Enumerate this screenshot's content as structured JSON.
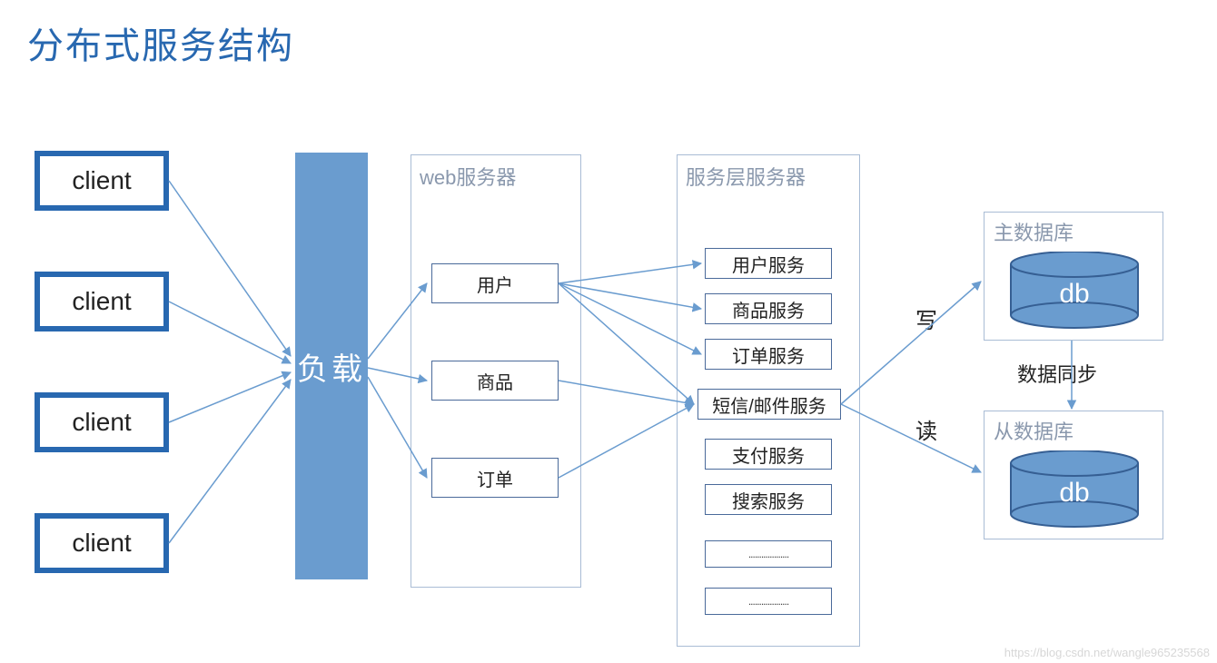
{
  "title": "分布式服务结构",
  "clients": [
    "client",
    "client",
    "client",
    "client"
  ],
  "load_label": "负载",
  "web_group": {
    "title": "web服务器",
    "items": [
      "用户",
      "商品",
      "订单"
    ]
  },
  "service_group": {
    "title": "服务层服务器",
    "items": [
      "用户服务",
      "商品服务",
      "订单服务",
      "短信/邮件服务",
      "支付服务",
      "搜索服务"
    ],
    "placeholders": [
      "...................",
      "..................."
    ]
  },
  "db_primary": {
    "title": "主数据库",
    "label": "db"
  },
  "db_replica": {
    "title": "从数据库",
    "label": "db"
  },
  "edge_labels": {
    "write": "写",
    "read": "读",
    "sync": "数据同步"
  },
  "watermark": "https://blog.csdn.net/wangle965235568"
}
